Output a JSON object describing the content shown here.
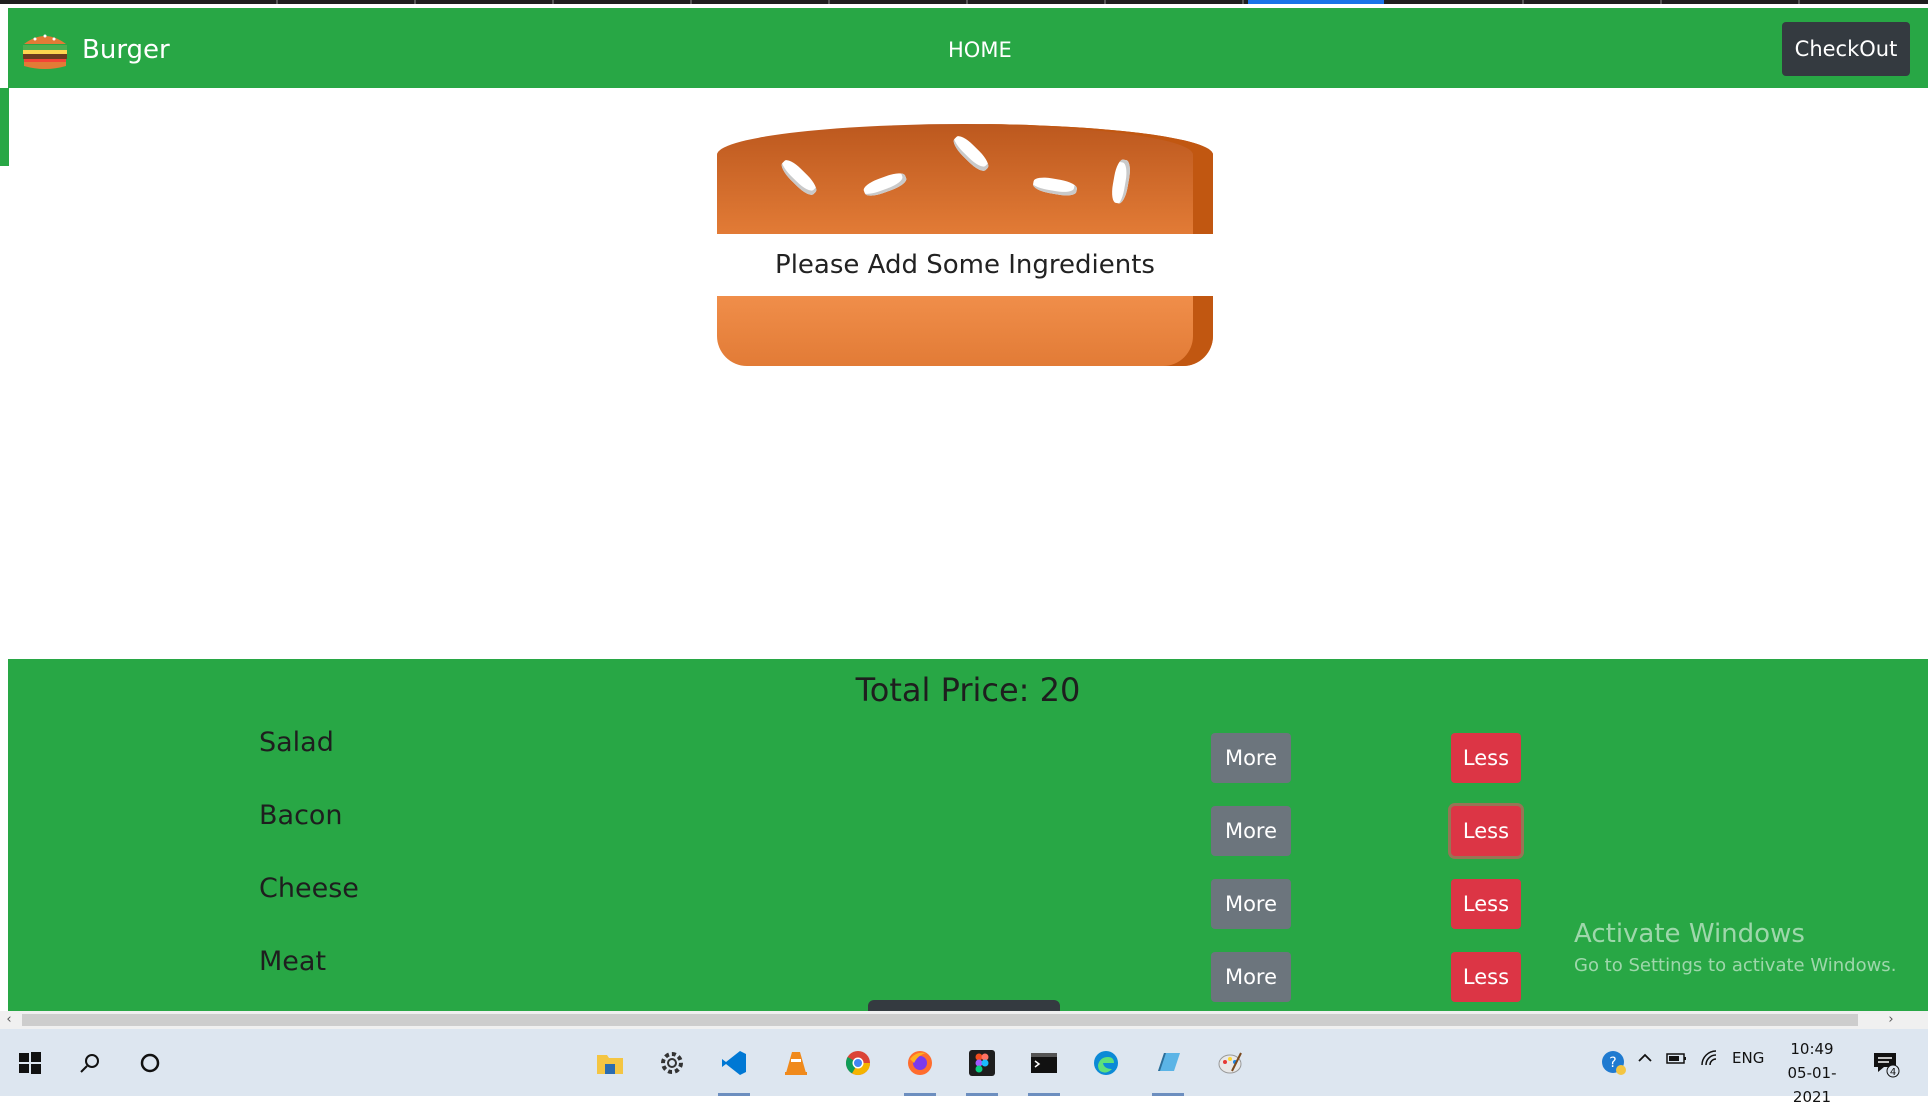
{
  "navbar": {
    "brand": "Burger",
    "home": "HOME",
    "checkout": "CheckOut"
  },
  "burger": {
    "message": "Please Add Some Ingredients"
  },
  "controls": {
    "total_price": "Total Price: 20",
    "ingredients": [
      {
        "label": "Salad",
        "more": "More",
        "less": "Less"
      },
      {
        "label": "Bacon",
        "more": "More",
        "less": "Less"
      },
      {
        "label": "Cheese",
        "more": "More",
        "less": "Less"
      },
      {
        "label": "Meat",
        "more": "More",
        "less": "Less"
      }
    ]
  },
  "watermark": {
    "line1": "Activate Windows",
    "line2": "Go to Settings to activate Windows."
  },
  "taskbar": {
    "language": "ENG",
    "time": "10:49",
    "date": "05-01-2021",
    "notification_count": "4",
    "apps": [
      "start-icon",
      "search-icon",
      "cortana-icon",
      "file-explorer-icon",
      "settings-icon",
      "vscode-icon",
      "vlc-icon",
      "chrome-icon",
      "firefox-icon",
      "figma-icon",
      "terminal-icon",
      "edge-icon",
      "app-icon",
      "paint-icon"
    ]
  },
  "colors": {
    "primary": "#28a745",
    "dark": "#343a40",
    "secondary": "#6c757d",
    "danger": "#dc3545",
    "bun": "#e27b36"
  }
}
